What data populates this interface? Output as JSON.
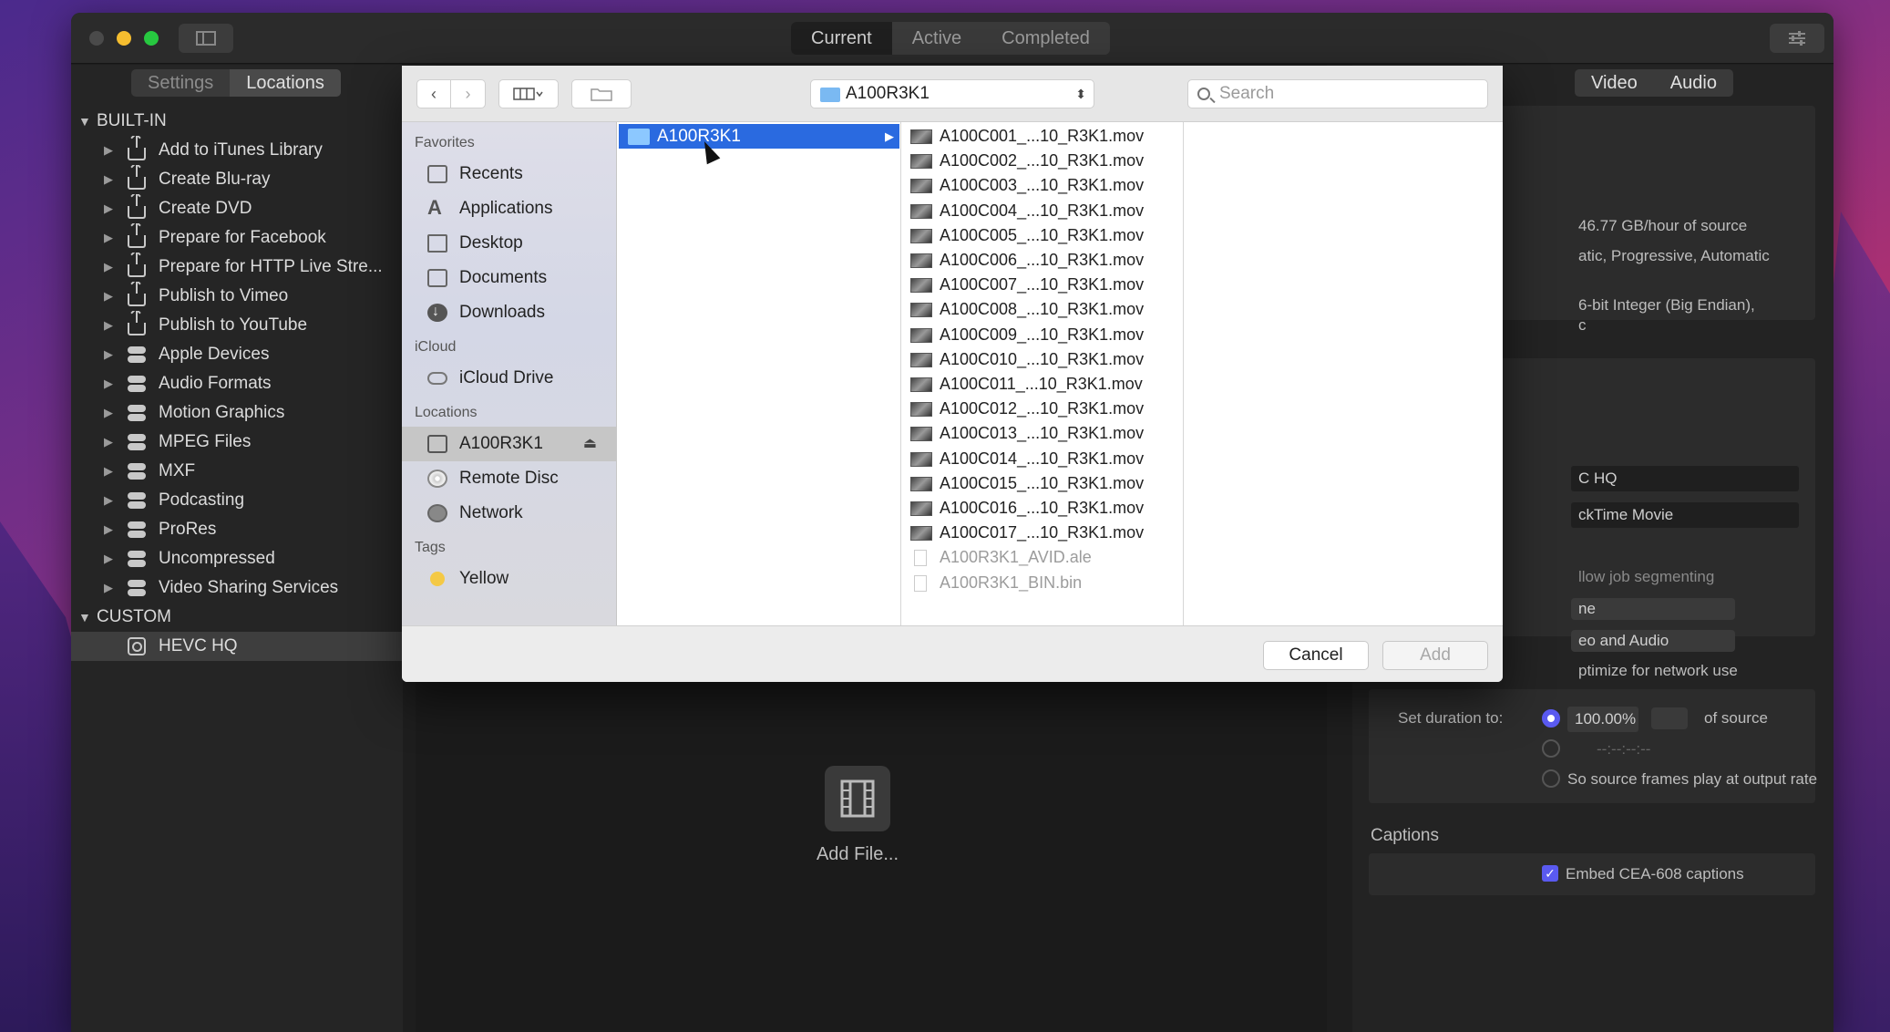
{
  "titlebar": {
    "tabs": [
      {
        "label": "Current",
        "selected": true
      },
      {
        "label": "Active",
        "selected": false
      },
      {
        "label": "Completed",
        "selected": false
      }
    ]
  },
  "left_panel": {
    "tabs": [
      {
        "label": "Settings",
        "selected": false
      },
      {
        "label": "Locations",
        "selected": true
      }
    ],
    "builtin_label": "BUILT-IN",
    "builtin_items": [
      {
        "label": "Add to iTunes Library",
        "icon": "share-icon"
      },
      {
        "label": "Create Blu-ray",
        "icon": "share-icon"
      },
      {
        "label": "Create DVD",
        "icon": "share-icon"
      },
      {
        "label": "Prepare for Facebook",
        "icon": "share-icon"
      },
      {
        "label": "Prepare for HTTP Live Stre...",
        "icon": "share-icon"
      },
      {
        "label": "Publish to Vimeo",
        "icon": "share-icon"
      },
      {
        "label": "Publish to YouTube",
        "icon": "share-icon"
      },
      {
        "label": "Apple Devices",
        "icon": "toggle-icon"
      },
      {
        "label": "Audio Formats",
        "icon": "toggle-icon"
      },
      {
        "label": "Motion Graphics",
        "icon": "toggle-icon"
      },
      {
        "label": "MPEG Files",
        "icon": "toggle-icon"
      },
      {
        "label": "MXF",
        "icon": "toggle-icon"
      },
      {
        "label": "Podcasting",
        "icon": "toggle-icon"
      },
      {
        "label": "ProRes",
        "icon": "toggle-icon"
      },
      {
        "label": "Uncompressed",
        "icon": "toggle-icon"
      },
      {
        "label": "Video Sharing Services",
        "icon": "toggle-icon"
      }
    ],
    "custom_label": "CUSTOM",
    "custom_items": [
      {
        "label": "HEVC HQ",
        "icon": "compressor-setting-icon"
      }
    ]
  },
  "center": {
    "add_file_label": "Add File..."
  },
  "inspector": {
    "tabs": [
      {
        "label": "Video"
      },
      {
        "label": "Audio"
      }
    ],
    "summary_lines": [
      "46.77 GB/hour of source",
      "atic, Progressive, Automatic",
      "6-bit Integer (Big Endian),",
      "c"
    ],
    "setting_name": "C HQ",
    "format": "ckTime Movie",
    "allow_segmenting": "llow job segmenting",
    "popup1": "ne",
    "popup2": "eo and Audio",
    "optimize": "ptimize for network use",
    "duration_label": "Set duration to:",
    "duration_value": "100.00%",
    "duration_suffix": "of source",
    "timecode": "--:--:--:--",
    "source_frames": "So source frames play at output rate",
    "captions_title": "Captions",
    "embed_captions": "Embed CEA-608 captions",
    "accent": "#5a5af0"
  },
  "dialog": {
    "path_label": "A100R3K1",
    "search_placeholder": "Search",
    "sidebar": {
      "favorites_label": "Favorites",
      "favorites": [
        {
          "label": "Recents",
          "icon": "recents-icon"
        },
        {
          "label": "Applications",
          "icon": "applications-icon"
        },
        {
          "label": "Desktop",
          "icon": "desktop-icon"
        },
        {
          "label": "Documents",
          "icon": "documents-icon"
        },
        {
          "label": "Downloads",
          "icon": "downloads-icon"
        }
      ],
      "icloud_label": "iCloud",
      "icloud": [
        {
          "label": "iCloud Drive",
          "icon": "cloud-icon"
        }
      ],
      "locations_label": "Locations",
      "locations": [
        {
          "label": "A100R3K1",
          "icon": "disk-icon",
          "selected": true
        },
        {
          "label": "Remote Disc",
          "icon": "disc-icon",
          "selected": false
        },
        {
          "label": "Network",
          "icon": "network-icon",
          "selected": false
        }
      ],
      "tags_label": "Tags",
      "tags": [
        {
          "label": "Yellow",
          "color": "#f4c945"
        }
      ]
    },
    "column1": [
      {
        "label": "A100R3K1",
        "selected": true
      }
    ],
    "files": [
      {
        "name": "A100C001_...10_R3K1.mov",
        "enabled": true
      },
      {
        "name": "A100C002_...10_R3K1.mov",
        "enabled": true
      },
      {
        "name": "A100C003_...10_R3K1.mov",
        "enabled": true
      },
      {
        "name": "A100C004_...10_R3K1.mov",
        "enabled": true
      },
      {
        "name": "A100C005_...10_R3K1.mov",
        "enabled": true
      },
      {
        "name": "A100C006_...10_R3K1.mov",
        "enabled": true
      },
      {
        "name": "A100C007_...10_R3K1.mov",
        "enabled": true
      },
      {
        "name": "A100C008_...10_R3K1.mov",
        "enabled": true
      },
      {
        "name": "A100C009_...10_R3K1.mov",
        "enabled": true
      },
      {
        "name": "A100C010_...10_R3K1.mov",
        "enabled": true
      },
      {
        "name": "A100C011_...10_R3K1.mov",
        "enabled": true
      },
      {
        "name": "A100C012_...10_R3K1.mov",
        "enabled": true
      },
      {
        "name": "A100C013_...10_R3K1.mov",
        "enabled": true
      },
      {
        "name": "A100C014_...10_R3K1.mov",
        "enabled": true
      },
      {
        "name": "A100C015_...10_R3K1.mov",
        "enabled": true
      },
      {
        "name": "A100C016_...10_R3K1.mov",
        "enabled": true
      },
      {
        "name": "A100C017_...10_R3K1.mov",
        "enabled": true
      },
      {
        "name": "A100R3K1_AVID.ale",
        "enabled": false
      },
      {
        "name": "A100R3K1_BIN.bin",
        "enabled": false
      }
    ],
    "cancel_label": "Cancel",
    "add_label": "Add"
  }
}
